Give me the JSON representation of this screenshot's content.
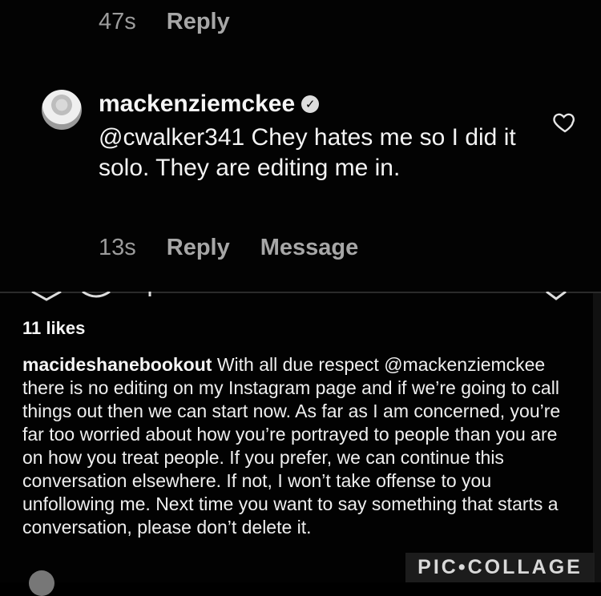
{
  "thread": {
    "prev_comment_meta": {
      "time": "47s",
      "reply": "Reply"
    },
    "comment": {
      "username": "mackenziemckee",
      "verified_icon": "verified-badge-icon",
      "text": "@cwalker341 Chey hates me so I did it solo. They are editing me in.",
      "time": "13s",
      "reply": "Reply",
      "message": "Message",
      "like_icon": "heart-outline-icon"
    }
  },
  "post": {
    "likes": "11 likes",
    "caption_username": "macideshanebookout",
    "caption_text": " With all due respect @mackenziemckee there is no editing on my Instagram page and if we’re going to call things out then we can start now.  As far as I am concerned, you’re far too worried about how you’re portrayed to people than you are on how you treat people. If you prefer, we can continue this conversation elsewhere. If not, I won’t take offense to you unfollowing me. Next time you want to say something that starts a conversation, please don’t delete it."
  },
  "watermark": {
    "text": "PIC•COLLAGE"
  }
}
